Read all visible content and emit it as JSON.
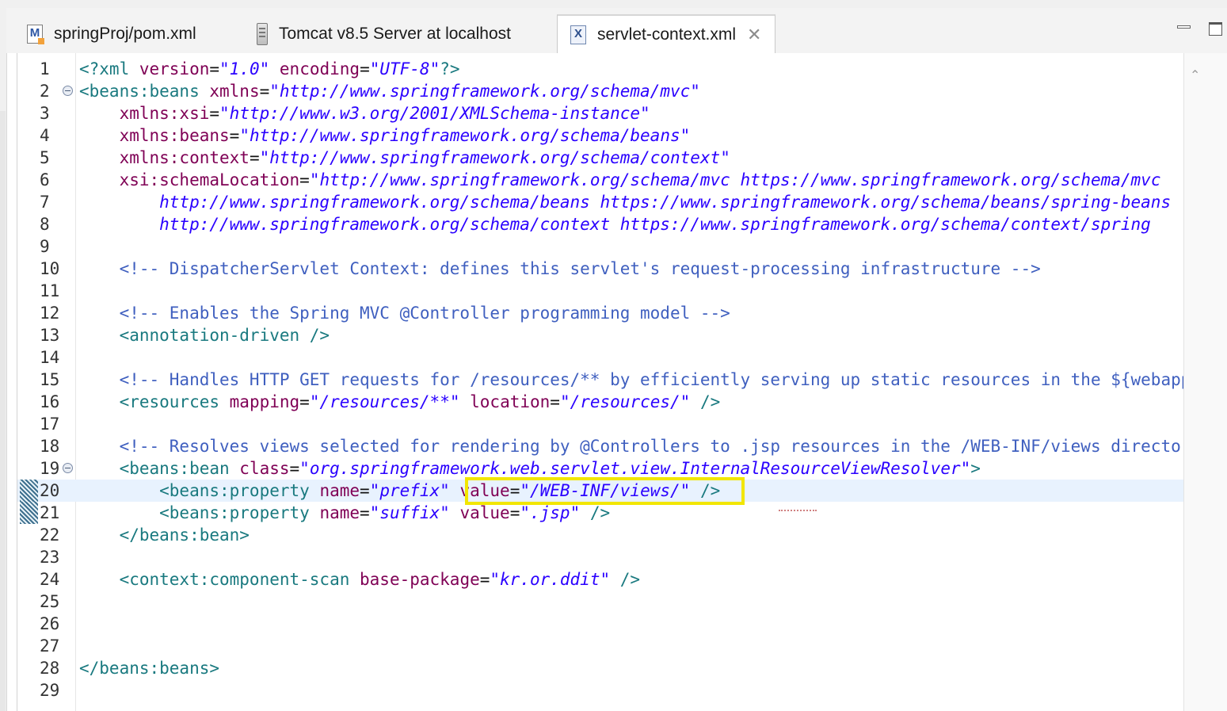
{
  "tabs": [
    {
      "label": "springProj/pom.xml",
      "icon": "maven-pom-icon",
      "active": false
    },
    {
      "label": "Tomcat v8.5 Server at localhost",
      "icon": "server-icon",
      "active": false
    },
    {
      "label": "servlet-context.xml",
      "icon": "xml-file-icon",
      "active": true
    }
  ],
  "icons": {
    "maven_letter": "M",
    "xml_letter": "X",
    "close_glyph": "✕",
    "scroll_up_glyph": "⌃"
  },
  "colors": {
    "tag": "#19797f",
    "attribute": "#7f0055",
    "string": "#2a00ff",
    "comment": "#3f5fbf",
    "current_line": "#e8f2fe",
    "highlight_box": "#f2e600"
  },
  "editor": {
    "current_line": 20,
    "lines": [
      {
        "n": "1",
        "tokens": [
          [
            "b",
            "<?xml "
          ],
          [
            "a",
            "version"
          ],
          [
            "p",
            "="
          ],
          [
            "v",
            "\"1.0\""
          ],
          [
            "p",
            " "
          ],
          [
            "a",
            "encoding"
          ],
          [
            "p",
            "="
          ],
          [
            "v",
            "\"UTF-8\""
          ],
          [
            "b",
            "?>"
          ]
        ]
      },
      {
        "n": "2",
        "fold": true,
        "tokens": [
          [
            "b",
            "<beans:beans "
          ],
          [
            "a",
            "xmlns"
          ],
          [
            "p",
            "="
          ],
          [
            "v",
            "\"http://www.springframework.org/schema/mvc\""
          ]
        ]
      },
      {
        "n": "3",
        "tokens": [
          [
            "p",
            "    "
          ],
          [
            "a",
            "xmlns:xsi"
          ],
          [
            "p",
            "="
          ],
          [
            "v",
            "\"http://www.w3.org/2001/XMLSchema-instance\""
          ]
        ]
      },
      {
        "n": "4",
        "tokens": [
          [
            "p",
            "    "
          ],
          [
            "a",
            "xmlns:beans"
          ],
          [
            "p",
            "="
          ],
          [
            "v",
            "\"http://www.springframework.org/schema/beans\""
          ]
        ]
      },
      {
        "n": "5",
        "tokens": [
          [
            "p",
            "    "
          ],
          [
            "a",
            "xmlns:context"
          ],
          [
            "p",
            "="
          ],
          [
            "v",
            "\"http://www.springframework.org/schema/context\""
          ]
        ]
      },
      {
        "n": "6",
        "tokens": [
          [
            "p",
            "    "
          ],
          [
            "a",
            "xsi:schemaLocation"
          ],
          [
            "p",
            "="
          ],
          [
            "v",
            "\"http://www.springframework.org/schema/mvc https://www.springframework.org/schema/mvc"
          ]
        ]
      },
      {
        "n": "7",
        "tokens": [
          [
            "v",
            "        http://www.springframework.org/schema/beans https://www.springframework.org/schema/beans/spring-beans"
          ]
        ]
      },
      {
        "n": "8",
        "tokens": [
          [
            "v",
            "        http://www.springframework.org/schema/context https://www.springframework.org/schema/context/spring"
          ]
        ]
      },
      {
        "n": "9",
        "tokens": []
      },
      {
        "n": "10",
        "tokens": [
          [
            "c",
            "    <!-- DispatcherServlet Context: defines this servlet's request-processing infrastructure -->"
          ]
        ]
      },
      {
        "n": "11",
        "tokens": []
      },
      {
        "n": "12",
        "tokens": [
          [
            "c",
            "    <!-- Enables the Spring MVC @Controller programming model -->"
          ]
        ]
      },
      {
        "n": "13",
        "tokens": [
          [
            "b",
            "    <annotation-driven />"
          ]
        ]
      },
      {
        "n": "14",
        "tokens": []
      },
      {
        "n": "15",
        "tokens": [
          [
            "c",
            "    <!-- Handles HTTP GET requests for /resources/** by efficiently serving up static resources in the ${webappRoot}"
          ]
        ]
      },
      {
        "n": "16",
        "tokens": [
          [
            "b",
            "    <resources "
          ],
          [
            "a",
            "mapping"
          ],
          [
            "p",
            "="
          ],
          [
            "v",
            "\"/resources/**\""
          ],
          [
            "p",
            " "
          ],
          [
            "a",
            "location"
          ],
          [
            "p",
            "="
          ],
          [
            "v",
            "\"/resources/\""
          ],
          [
            "b",
            " />"
          ]
        ]
      },
      {
        "n": "17",
        "tokens": []
      },
      {
        "n": "18",
        "tokens": [
          [
            "c",
            "    <!-- Resolves views selected for rendering by @Controllers to .jsp resources in the /WEB-INF/views directory -->"
          ]
        ]
      },
      {
        "n": "19",
        "fold": true,
        "tokens": [
          [
            "b",
            "    <beans:bean "
          ],
          [
            "a",
            "class"
          ],
          [
            "p",
            "="
          ],
          [
            "v",
            "\"org.springframework.web.servlet.view.InternalResourceViewResolver\""
          ],
          [
            "b",
            ">"
          ]
        ]
      },
      {
        "n": "20",
        "marker": true,
        "tokens": [
          [
            "b",
            "        <beans:property "
          ],
          [
            "a",
            "name"
          ],
          [
            "p",
            "="
          ],
          [
            "v",
            "\"prefix\""
          ],
          [
            "p",
            " "
          ],
          [
            "a",
            "value"
          ],
          [
            "p",
            "="
          ],
          [
            "v",
            "\"/WEB-INF/views/\""
          ],
          [
            "b",
            " />"
          ]
        ]
      },
      {
        "n": "21",
        "marker": true,
        "tokens": [
          [
            "b",
            "        <beans:property "
          ],
          [
            "a",
            "name"
          ],
          [
            "p",
            "="
          ],
          [
            "v",
            "\"suffix\""
          ],
          [
            "p",
            " "
          ],
          [
            "a",
            "value"
          ],
          [
            "p",
            "="
          ],
          [
            "v",
            "\".jsp\""
          ],
          [
            "b",
            " />"
          ]
        ]
      },
      {
        "n": "22",
        "tokens": [
          [
            "b",
            "    </beans:bean>"
          ]
        ]
      },
      {
        "n": "23",
        "tokens": []
      },
      {
        "n": "24",
        "tokens": [
          [
            "b",
            "    <context:component-scan "
          ],
          [
            "a",
            "base-package"
          ],
          [
            "p",
            "="
          ],
          [
            "v",
            "\"kr.or.ddit\""
          ],
          [
            "b",
            " />"
          ]
        ]
      },
      {
        "n": "25",
        "tokens": []
      },
      {
        "n": "26",
        "tokens": []
      },
      {
        "n": "27",
        "tokens": []
      },
      {
        "n": "28",
        "tokens": [
          [
            "b",
            "</beans:beans>"
          ]
        ]
      },
      {
        "n": "29",
        "tokens": []
      }
    ]
  }
}
